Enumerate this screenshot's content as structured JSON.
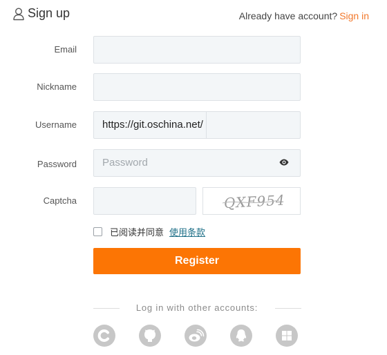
{
  "header": {
    "title": "Sign up",
    "have_account_text": "Already have account?",
    "sign_in_link": "Sign in"
  },
  "form": {
    "email_label": "Email",
    "nickname_label": "Nickname",
    "username_label": "Username",
    "username_prefix": "https://git.oschina.net/",
    "password_label": "Password",
    "password_placeholder": "Password",
    "captcha_label": "Captcha",
    "captcha_text": "QXF954",
    "agree_text": "已阅读并同意",
    "terms_link": "使用条款",
    "register_button": "Register"
  },
  "other_login": {
    "divider_text": "Log in with other accounts:",
    "providers": [
      "c-icon",
      "github-icon",
      "weibo-icon",
      "qq-icon",
      "windows-icon"
    ]
  },
  "colors": {
    "accent": "#fc7504",
    "link": "#f2782b",
    "terms": "#1e6f87",
    "input_bg": "#f3f6f8"
  }
}
